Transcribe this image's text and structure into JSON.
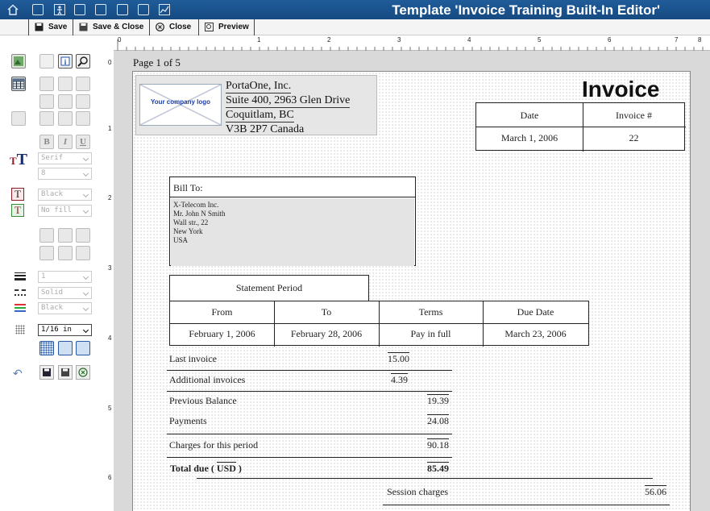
{
  "header": {
    "title": "Template 'Invoice Training Built-In Editor'",
    "nav_icons": [
      "home-icon",
      "dashboard-icon",
      "user-icon",
      "grid-icon",
      "export-icon",
      "sitemap-icon",
      "search-icon",
      "chart-icon"
    ]
  },
  "toolbar": {
    "save_label": "Save",
    "save_close_label": "Save & Close",
    "close_label": "Close",
    "preview_label": "Preview"
  },
  "palette": {
    "font_family": "Serif",
    "font_size": "8",
    "text_color": "Black",
    "fill_color": "No fill",
    "line_width": "1",
    "line_style": "Solid",
    "line_color": "Black",
    "grid_size": "1/16 in"
  },
  "rulers": {
    "top": [
      "0",
      "1",
      "2",
      "3",
      "4",
      "5",
      "6",
      "7",
      "8"
    ],
    "left": [
      "0",
      "1",
      "2",
      "3",
      "4",
      "5",
      "6"
    ]
  },
  "document": {
    "page_label": "Page 1 of 5",
    "logo_text": "Your company logo",
    "company": {
      "name": "PortaOne, Inc.",
      "line1": "Suite 400, 2963 Glen Drive",
      "line2": "Coquitlam, BC",
      "line3": "V3B 2P7 Canada"
    },
    "invoice_title": "Invoice",
    "date_header": "Date",
    "invoice_no_header": "Invoice #",
    "date_value": "March 1, 2006",
    "invoice_no_value": "22",
    "bill_to_label": "Bill To:",
    "bill_to_lines": [
      "X-Telecom Inc.",
      "Mr. John N Smith",
      "Wall str., 22",
      "New York",
      "USA"
    ],
    "statement_period_label": "Statement Period",
    "period_headers": [
      "From",
      "To",
      "Terms",
      "Due Date"
    ],
    "period_values": [
      "February 1, 2006",
      "February 28, 2006",
      "Pay in full",
      "March 23, 2006"
    ],
    "summary": [
      {
        "label": "Last invoice",
        "value": "15.00"
      },
      {
        "label": "Additional invoices",
        "value": "4.39"
      },
      {
        "label": "Previous Balance",
        "value": "19.39"
      },
      {
        "label": "Payments",
        "value": "24.08"
      },
      {
        "label": "Charges for this period",
        "value": "90.18"
      }
    ],
    "total_label": "Total due (",
    "total_currency": "USD",
    "total_close": ")",
    "total_value": "85.49",
    "session_label": "Session charges",
    "session_value": "56.06"
  }
}
